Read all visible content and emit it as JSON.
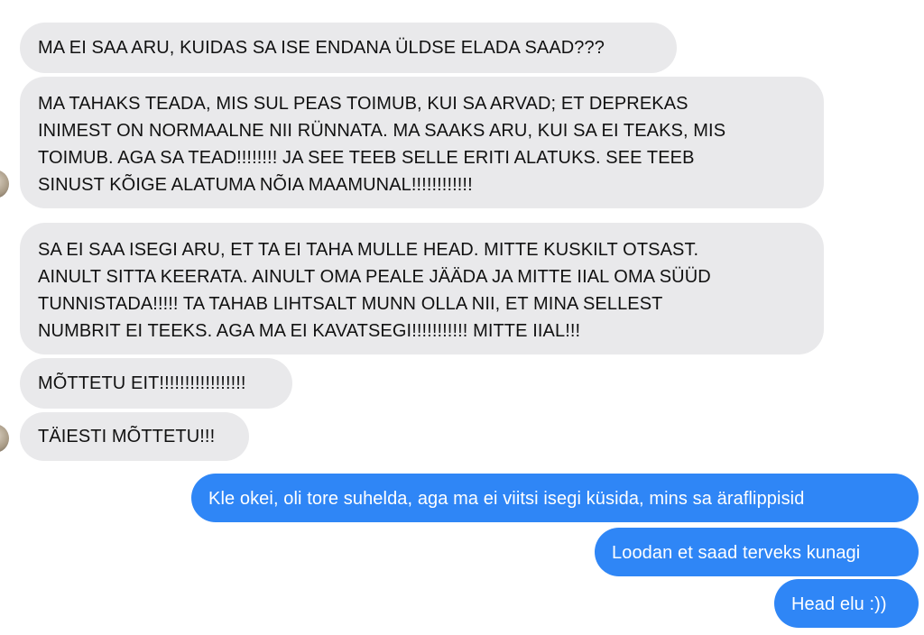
{
  "conversation": {
    "incoming": [
      "MA EI SAA ARU, KUIDAS SA ISE ENDANA ÜLDSE ELADA SAAD???",
      "MA TAHAKS TEADA, MIS SUL PEAS TOIMUB, KUI SA ARVAD; ET DEPREKAS\nINIMEST ON NORMAALNE NII RÜNNATA. MA SAAKS ARU, KUI SA EI TEAKS, MIS\nTOIMUB. AGA SA TEAD!!!!!!!! JA SEE TEEB SELLE ERITI ALATUKS. SEE TEEB\nSINUST KÕIGE ALATUMA NÕIA MAAMUNAL!!!!!!!!!!!!",
      "SA EI SAA ISEGI ARU, ET TA EI TAHA MULLE HEAD. MITTE KUSKILT OTSAST.\nAINULT SITTA KEERATA. AINULT OMA PEALE JÄÄDA JA MITTE IIAL OMA SÜÜD\nTUNNISTADA!!!!! TA TAHAB LIHTSALT MUNN OLLA NII, ET MINA SELLEST\nNUMBRIT EI TEEKS. AGA MA EI KAVATSEGI!!!!!!!!!!! MITTE IIAL!!!",
      "MÕTTETU EIT!!!!!!!!!!!!!!!!!",
      "TÄIESTI MÕTTETU!!!"
    ],
    "outgoing": [
      "Kle okei, oli tore suhelda, aga ma ei viitsi isegi küsida, mins sa äraflippisid",
      "Loodan et saad terveks kunagi",
      "Head elu :))"
    ],
    "colors": {
      "incoming_bg": "#e9e9eb",
      "outgoing_bg": "#2f86f6",
      "incoming_text": "#111111",
      "outgoing_text": "#ffffff"
    },
    "icons": [
      "contact-avatar-icon"
    ]
  }
}
